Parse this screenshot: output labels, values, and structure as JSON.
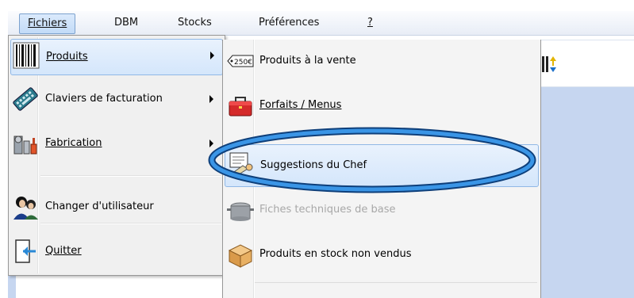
{
  "menubar": {
    "items": [
      {
        "label": "Fichiers"
      },
      {
        "label": "DBM"
      },
      {
        "label": "Stocks"
      },
      {
        "label": "Préférences"
      },
      {
        "label": "?"
      }
    ]
  },
  "main_menu": {
    "items": [
      {
        "label": "Produits",
        "icon": "barcode-icon",
        "has_submenu": true,
        "highlighted": true
      },
      {
        "label": "Claviers de facturation",
        "icon": "keyboard-icon",
        "has_submenu": true
      },
      {
        "label": "Fabrication",
        "icon": "factory-icon",
        "has_submenu": true
      },
      {
        "label": "Changer d'utilisateur",
        "icon": "users-icon",
        "has_submenu": false
      },
      {
        "label": "Quitter",
        "icon": "exit-door-icon",
        "has_submenu": false
      }
    ]
  },
  "sub_menu": {
    "items": [
      {
        "label": "Produits à la vente",
        "icon": "price-tag-icon"
      },
      {
        "label": "Forfaits / Menus",
        "icon": "toolbox-icon"
      },
      {
        "label": "Suggestions du Chef",
        "icon": "chef-note-icon",
        "highlighted": true
      },
      {
        "label": "Fiches techniques de base",
        "icon": "cooking-pot-icon",
        "disabled": true
      },
      {
        "label": "Produits en stock non vendus",
        "icon": "box-icon"
      }
    ]
  },
  "icons": {
    "price_tag_text": "250€"
  },
  "colors": {
    "menu_highlight": "#d4e6fb",
    "annotation_ellipse": "#1f6fc4",
    "workspace": "#c6d6f0",
    "disabled_text": "#a8a8a8"
  }
}
